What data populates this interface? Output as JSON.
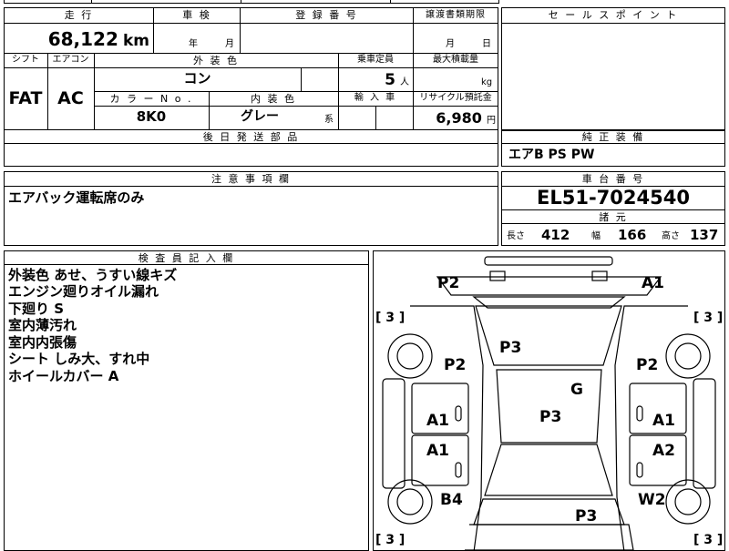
{
  "mileage": {
    "header": "走 行",
    "value": "68,122",
    "unit": "km"
  },
  "inspection": {
    "header": "車 検",
    "year_unit": "年",
    "month_unit": "月"
  },
  "registration": {
    "header": "登 録 番 号"
  },
  "transfer_docs": {
    "header": "譲渡書類期限",
    "month_unit": "月",
    "day_unit": "日"
  },
  "sales_point": {
    "header": "セ ー ル ス ポ イ ン ト"
  },
  "shift": {
    "header": "シフト",
    "value": "FAT"
  },
  "aircon": {
    "header": "エアコン",
    "value": "AC"
  },
  "exterior_color": {
    "header": "外 装 色",
    "value": "コン"
  },
  "capacity": {
    "header": "乗車定員",
    "value": "5",
    "unit": "人"
  },
  "max_load": {
    "header": "最大積載量",
    "unit": "kg"
  },
  "color_no": {
    "header": "カ ラ ー N o .",
    "value": "8K0"
  },
  "interior_color": {
    "header": "内 装 色",
    "value": "グレー",
    "suffix": "系"
  },
  "import": {
    "header": "輸 入 車"
  },
  "recycle": {
    "header": "リサイクル預託金",
    "value": "6,980",
    "unit": "円"
  },
  "later_parts": {
    "header": "後 日 発 送 部 品"
  },
  "equipment": {
    "header": "純 正 装 備",
    "value": "エアB PS PW"
  },
  "cautions": {
    "header": "注 意 事 項 欄",
    "text": "エアバック運転席のみ"
  },
  "chassis": {
    "header": "車 台 番 号",
    "value": "EL51-7024540"
  },
  "specs": {
    "header": "諸 元",
    "length_label": "長さ",
    "length": "412",
    "width_label": "幅",
    "width": "166",
    "height_label": "高さ",
    "height": "137"
  },
  "inspector": {
    "header": "検 査 員 記 入 欄",
    "lines": [
      "外装色 あせ、うすい線キズ",
      "エンジン廻りオイル漏れ",
      "下廻り S",
      "室内薄汚れ",
      "室内内張傷",
      "シート しみ大、すれ中",
      "ホイールカバー A"
    ]
  },
  "diagram": {
    "marks": [
      "P2",
      "A1",
      "P3",
      "P2",
      "P2",
      "G",
      "P3",
      "A1",
      "A1",
      "A1",
      "A2",
      "B4",
      "W2",
      "P3"
    ],
    "tires": [
      "[ 3 ]",
      "[ 3 ]",
      "[ 3 ]",
      "[ 3 ]"
    ]
  }
}
